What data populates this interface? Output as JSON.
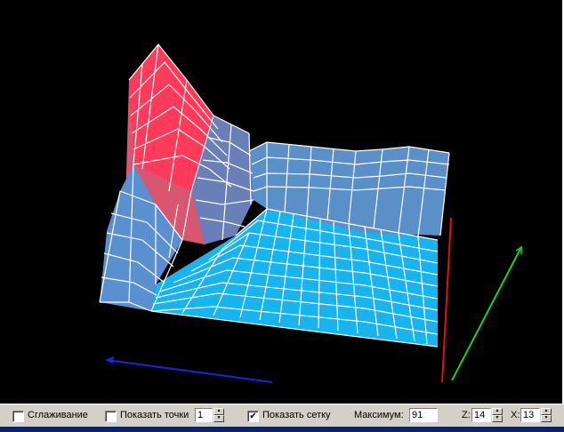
{
  "toolbar": {
    "smoothing": {
      "label": "Сглаживание",
      "checked": false
    },
    "show_points": {
      "label": "Показать точки",
      "checked": false,
      "value": "1"
    },
    "show_grid": {
      "label": "Показать сетку",
      "checked": true
    },
    "maximum": {
      "label": "Максимум:",
      "value": "91"
    },
    "z": {
      "label": "Z:",
      "value": "14"
    },
    "x": {
      "label": "X:",
      "value": "13"
    }
  },
  "colors": {
    "background": "#000000",
    "surface_low": "#1ab2f0",
    "surface_mid": "#5b8ec8",
    "surface_high": "#ff3a5a",
    "grid": "#ffffff",
    "axis_x": "#2020e0",
    "axis_y": "#e01010",
    "axis_z": "#20d020"
  },
  "icons": {
    "check": "✔",
    "spin_up": "▲",
    "spin_down": "▼"
  }
}
